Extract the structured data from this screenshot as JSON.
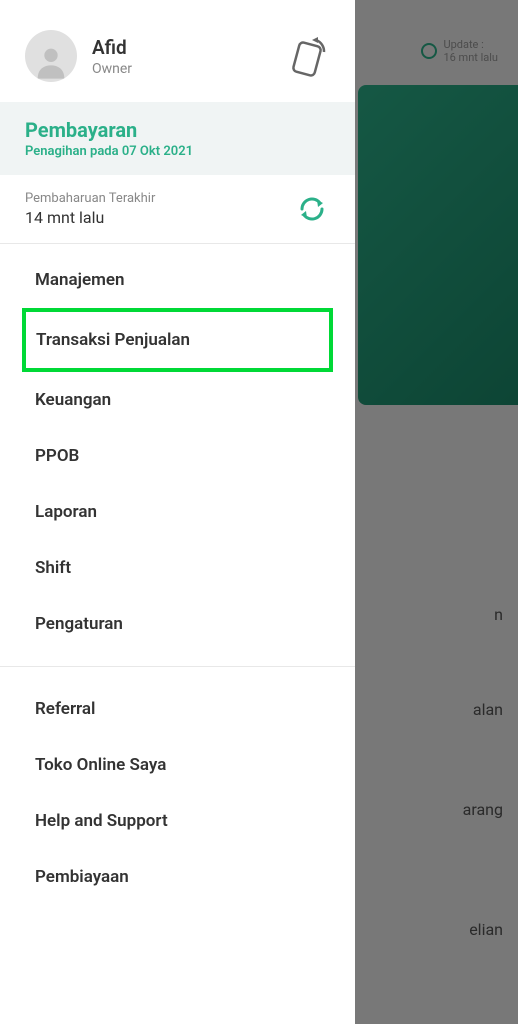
{
  "backdrop": {
    "update_label": "Update :",
    "update_time": "16 mnt lalu",
    "text1": "n",
    "text2": "alan",
    "text3": "arang",
    "text4": "elian"
  },
  "profile": {
    "name": "Afid",
    "role": "Owner"
  },
  "payment": {
    "title": "Pembayaran",
    "subtitle": "Penagihan pada 07 Okt 2021"
  },
  "update": {
    "label": "Pembaharuan Terakhir",
    "time": "14 mnt lalu"
  },
  "menu": {
    "group1": [
      {
        "label": "Manajemen"
      },
      {
        "label": "Transaksi Penjualan",
        "highlighted": true
      },
      {
        "label": "Keuangan"
      },
      {
        "label": "PPOB"
      },
      {
        "label": "Laporan"
      },
      {
        "label": "Shift"
      },
      {
        "label": "Pengaturan"
      }
    ],
    "group2": [
      {
        "label": "Referral"
      },
      {
        "label": "Toko Online Saya"
      },
      {
        "label": "Help and Support"
      },
      {
        "label": "Pembiayaan"
      }
    ]
  }
}
